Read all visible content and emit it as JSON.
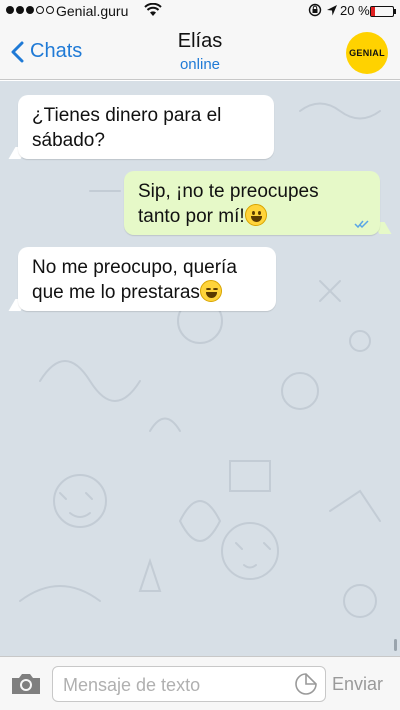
{
  "status_bar": {
    "carrier": "Genial.guru",
    "battery_percent": "20 %",
    "battery_level": 0.2
  },
  "nav": {
    "back_label": "Chats",
    "contact_name": "Elías",
    "contact_status": "online",
    "avatar_text": "GENIAL"
  },
  "messages": [
    {
      "direction": "incoming",
      "lines": [
        "¿Tienes dinero para el",
        "sábado?"
      ]
    },
    {
      "direction": "outgoing",
      "lines": [
        "Sip, ¡no te preocupes",
        "tanto por mí!"
      ],
      "emoji": "grinning-face",
      "status": "read"
    },
    {
      "direction": "incoming",
      "lines": [
        "No me preocupo, quería",
        "que me lo prestaras"
      ],
      "emoji": "laughing-face"
    }
  ],
  "input": {
    "placeholder": "Mensaje de texto",
    "send_label": "Enviar"
  },
  "colors": {
    "accent": "#1f7ad6",
    "outgoing_bubble": "#e6f9c8",
    "chat_background": "#d7dfe6",
    "avatar": "#ffd200"
  }
}
